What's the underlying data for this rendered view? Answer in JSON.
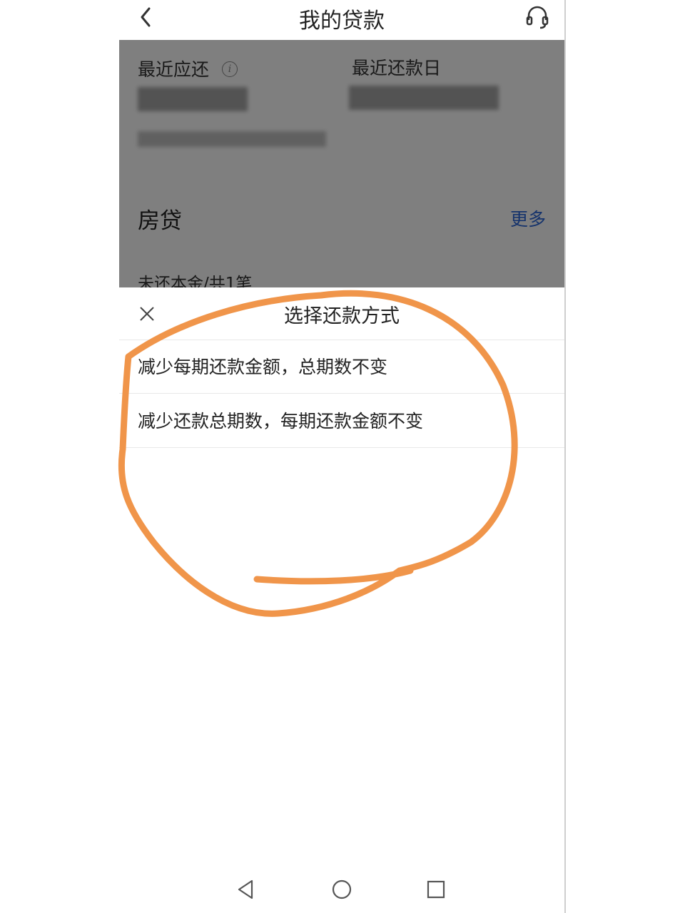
{
  "header": {
    "title": "我的贷款"
  },
  "summary": {
    "next_due_label": "最近应还",
    "next_date_label": "最近还款日"
  },
  "mortgage": {
    "section_title": "房贷",
    "more_link": "更多",
    "remaining_principal_label": "未还本金/共1笔"
  },
  "sheet": {
    "title": "选择还款方式",
    "options": [
      {
        "label": "减少每期还款金额，总期数不变"
      },
      {
        "label": "减少还款总期数，每期还款金额不变"
      }
    ]
  },
  "annotation": {
    "color": "#f0954a"
  },
  "icons": {
    "back": "chevron-left-icon",
    "support": "headset-icon",
    "info": "info-icon",
    "close": "close-icon",
    "nav_back": "triangle-back-icon",
    "nav_home": "circle-home-icon",
    "nav_recent": "square-recent-icon"
  }
}
